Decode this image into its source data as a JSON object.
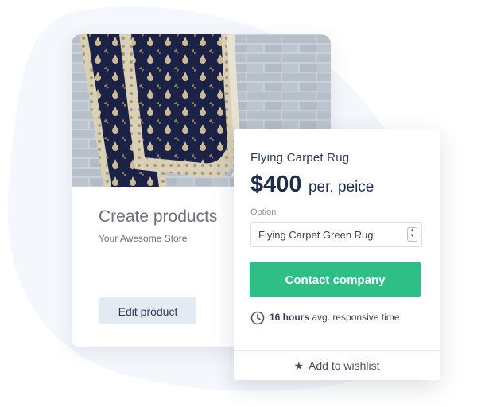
{
  "back_card": {
    "title": "Create products",
    "subtitle": "Your Awesome Store",
    "edit_label": "Edit product"
  },
  "product": {
    "name": "Flying Carpet Rug",
    "price": "$400",
    "price_unit": "per. peice",
    "option_label": "Option",
    "option_value": "Flying Carpet Green Rug",
    "contact_label": "Contact company",
    "response_hours": "16 hours",
    "response_text": "avg. responsive time",
    "wishlist_label": "Add to wishlist"
  },
  "icons": {
    "clock": "clock-icon",
    "star": "star-icon",
    "stepper": "stepper-icon"
  },
  "colors": {
    "accent_green": "#2ebf87",
    "navy_text": "#1f2d4d",
    "edit_button_bg": "#e3eaf2",
    "blob_bg": "#f4f7fb"
  }
}
